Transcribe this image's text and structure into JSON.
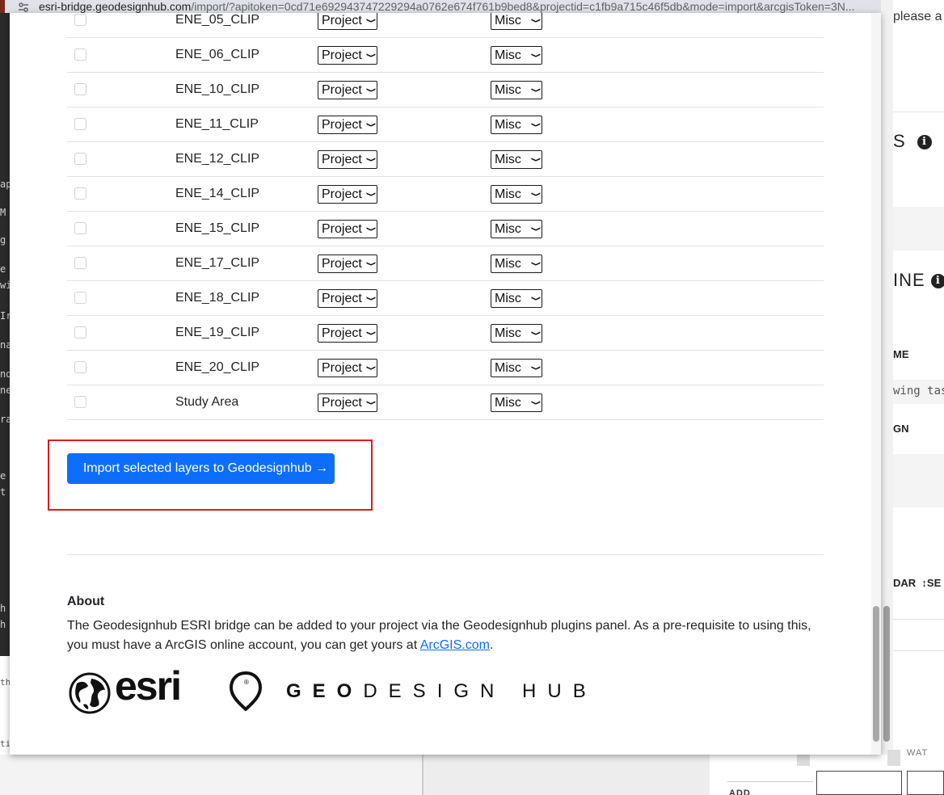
{
  "browser": {
    "url_host": "esri-bridge.geodesignhub.com",
    "url_rest": "/import/?apitoken=0cd71e692943747229294a0762e674f761b9bed8&projectid=c1fb9a715c46f5db&mode=import&arcgisToken=3N..."
  },
  "layers": [
    {
      "name": "ENE_05_CLIP",
      "role": "Project",
      "category": "Misc"
    },
    {
      "name": "ENE_06_CLIP",
      "role": "Project",
      "category": "Misc"
    },
    {
      "name": "ENE_10_CLIP",
      "role": "Project",
      "category": "Misc"
    },
    {
      "name": "ENE_11_CLIP",
      "role": "Project",
      "category": "Misc"
    },
    {
      "name": "ENE_12_CLIP",
      "role": "Project",
      "category": "Misc"
    },
    {
      "name": "ENE_14_CLIP",
      "role": "Project",
      "category": "Misc"
    },
    {
      "name": "ENE_15_CLIP",
      "role": "Project",
      "category": "Misc"
    },
    {
      "name": "ENE_17_CLIP",
      "role": "Project",
      "category": "Misc"
    },
    {
      "name": "ENE_18_CLIP",
      "role": "Project",
      "category": "Misc"
    },
    {
      "name": "ENE_19_CLIP",
      "role": "Project",
      "category": "Misc"
    },
    {
      "name": "ENE_20_CLIP",
      "role": "Project",
      "category": "Misc"
    },
    {
      "name": "Study Area",
      "role": "Project",
      "category": "Misc"
    }
  ],
  "import_button_label": "Import selected layers to Geodesignhub →",
  "about": {
    "heading": "About",
    "text_before_link": "The Geodesignhub ESRI bridge can be added to your project via the Geodesignhub plugins panel. As a pre-requisite to using this, you must have a ArcGIS online account, you can get yours at ",
    "link_text": "ArcGIS.com",
    "text_after_link": "."
  },
  "logos": {
    "esri": "esri",
    "esri_mark": "®",
    "geodesignhub_bold": "GEO",
    "geodesignhub_rest": "DESIGN HUB"
  },
  "background": {
    "right_fragments": [
      "please a",
      "S",
      "INE",
      "ME",
      "wing task",
      "GN",
      "DAR",
      "↕SE"
    ],
    "left_fragments": [
      "ap",
      "M",
      "g",
      "e",
      "wi",
      "Ir",
      "na",
      "nd",
      "ne",
      "ra",
      "e",
      "t",
      "h",
      "h",
      "th",
      "ti"
    ],
    "bottom_fragments": [
      "WAT",
      "ADD"
    ]
  }
}
